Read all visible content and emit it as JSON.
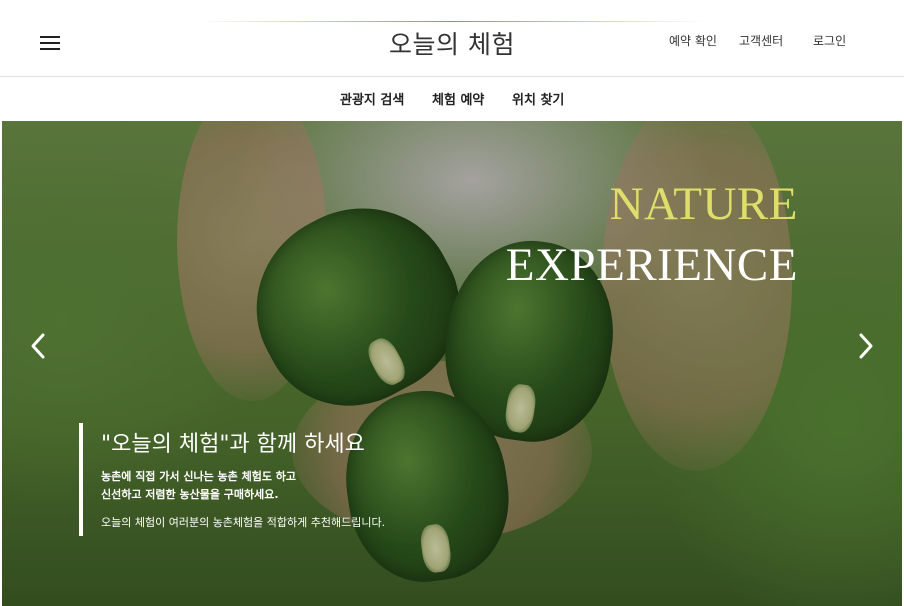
{
  "header": {
    "site_title": "오늘의 체험",
    "menu_icon": "hamburger-menu-icon",
    "links": {
      "reservation_check": "예약 확인",
      "customer_center": "고객센터",
      "login": "로그인"
    }
  },
  "nav": {
    "items": [
      "관광지 검색",
      "체험 예약",
      "위치 찾기"
    ]
  },
  "hero": {
    "heading_line1": "NATURE",
    "heading_line2": "EXPERIENCE",
    "heading_line1_color": "#e0de6a",
    "quote_title": "\"오늘의 체험\"과 함께 하세요",
    "desc_line1": "농촌에 직접 가서 신나는 농촌 체험도 하고",
    "desc_line2": "신선하고 저렴한 농산물을 구매하세요.",
    "note": "오늘의 체험이 여러분의 농촌체험을 적합하게 추천해드립니다.",
    "prev_icon": "chevron-left-icon",
    "next_icon": "chevron-right-icon"
  }
}
